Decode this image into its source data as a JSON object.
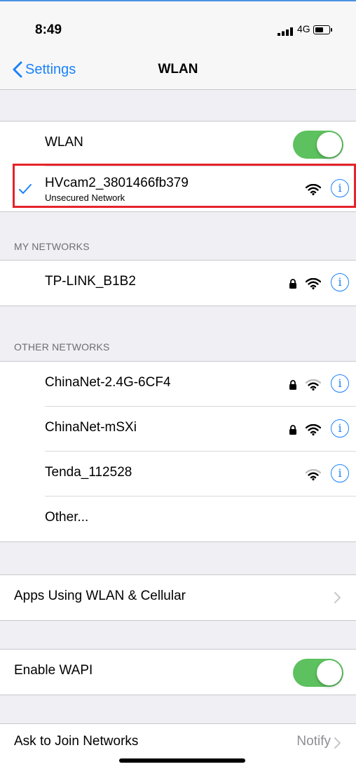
{
  "status_bar": {
    "time": "8:49",
    "network": "4G"
  },
  "nav": {
    "back_label": "Settings",
    "title": "WLAN"
  },
  "wlan_group": {
    "wlan_label": "WLAN",
    "wlan_on": true,
    "connected": {
      "name": "HVcam2_3801466fb379",
      "subtitle": "Unsecured Network"
    }
  },
  "my_networks": {
    "header": "MY NETWORKS",
    "items": [
      {
        "name": "TP-LINK_B1B2",
        "secured": true
      }
    ]
  },
  "other_networks": {
    "header": "OTHER NETWORKS",
    "items": [
      {
        "name": "ChinaNet-2.4G-6CF4",
        "secured": true
      },
      {
        "name": "ChinaNet-mSXi",
        "secured": true
      },
      {
        "name": "Tenda_112528",
        "secured": false
      }
    ],
    "other_label": "Other..."
  },
  "apps_row": {
    "label": "Apps Using WLAN & Cellular"
  },
  "wapi_row": {
    "label": "Enable WAPI",
    "on": true
  },
  "ask_row": {
    "label": "Ask to Join Networks",
    "value": "Notify"
  },
  "colors": {
    "accent": "#1a82fb",
    "toggle_on": "#5cc15e",
    "highlight": "#e6232a"
  }
}
